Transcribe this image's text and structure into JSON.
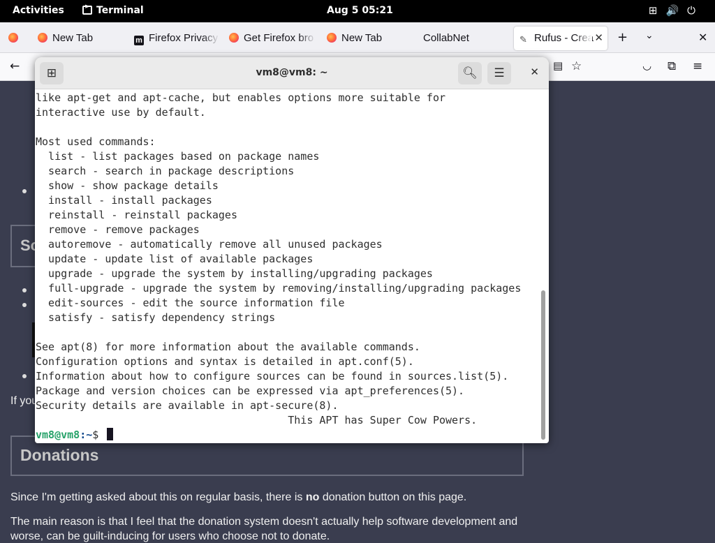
{
  "topbar": {
    "activities": "Activities",
    "app_name": "Terminal",
    "clock": "Aug 5  05:21"
  },
  "browser": {
    "tabs": [
      {
        "label": "",
        "icon": "firefox-icon",
        "active": false
      },
      {
        "label": "New Tab",
        "icon": "firefox-icon",
        "active": false
      },
      {
        "label": "Firefox Privacy",
        "icon": "mozilla-m-icon",
        "active": false
      },
      {
        "label": "Get Firefox bro",
        "icon": "firefox-icon",
        "active": false
      },
      {
        "label": "New Tab",
        "icon": "firefox-icon",
        "active": false
      },
      {
        "label": "CollabNet",
        "icon": "",
        "active": false
      },
      {
        "label": "Rufus - Crea",
        "icon": "rufus-icon",
        "active": true
      }
    ]
  },
  "page": {
    "heading_donations": "Donations",
    "heading_partial": "Sc",
    "text_if_you": "If you",
    "paragraph1_before": "Since I'm getting asked about this on regular basis, there is ",
    "paragraph1_bold": "no",
    "paragraph1_after": " donation button on this page.",
    "paragraph2_line1": "The main reason is that I feel that the donation system doesn't actually help software development and",
    "paragraph2_line2": "worse, can be guilt-inducing for users who choose not to donate."
  },
  "terminal": {
    "title": "vm8@vm8: ~",
    "lines": [
      "like apt-get and apt-cache, but enables options more suitable for",
      "interactive use by default.",
      "",
      "Most used commands:",
      "  list - list packages based on package names",
      "  search - search in package descriptions",
      "  show - show package details",
      "  install - install packages",
      "  reinstall - reinstall packages",
      "  remove - remove packages",
      "  autoremove - automatically remove all unused packages",
      "  update - update list of available packages",
      "  upgrade - upgrade the system by installing/upgrading packages",
      "  full-upgrade - upgrade the system by removing/installing/upgrading packages",
      "  edit-sources - edit the source information file",
      "  satisfy - satisfy dependency strings",
      "",
      "See apt(8) for more information about the available commands.",
      "Configuration options and syntax is detailed in apt.conf(5).",
      "Information about how to configure sources can be found in sources.list(5).",
      "Package and version choices can be expressed via apt_preferences(5).",
      "Security details are available in apt-secure(8).",
      "                                        This APT has Super Cow Powers."
    ],
    "prompt_user": "vm8@vm8",
    "prompt_path": ":~",
    "prompt_symbol": "$ "
  }
}
